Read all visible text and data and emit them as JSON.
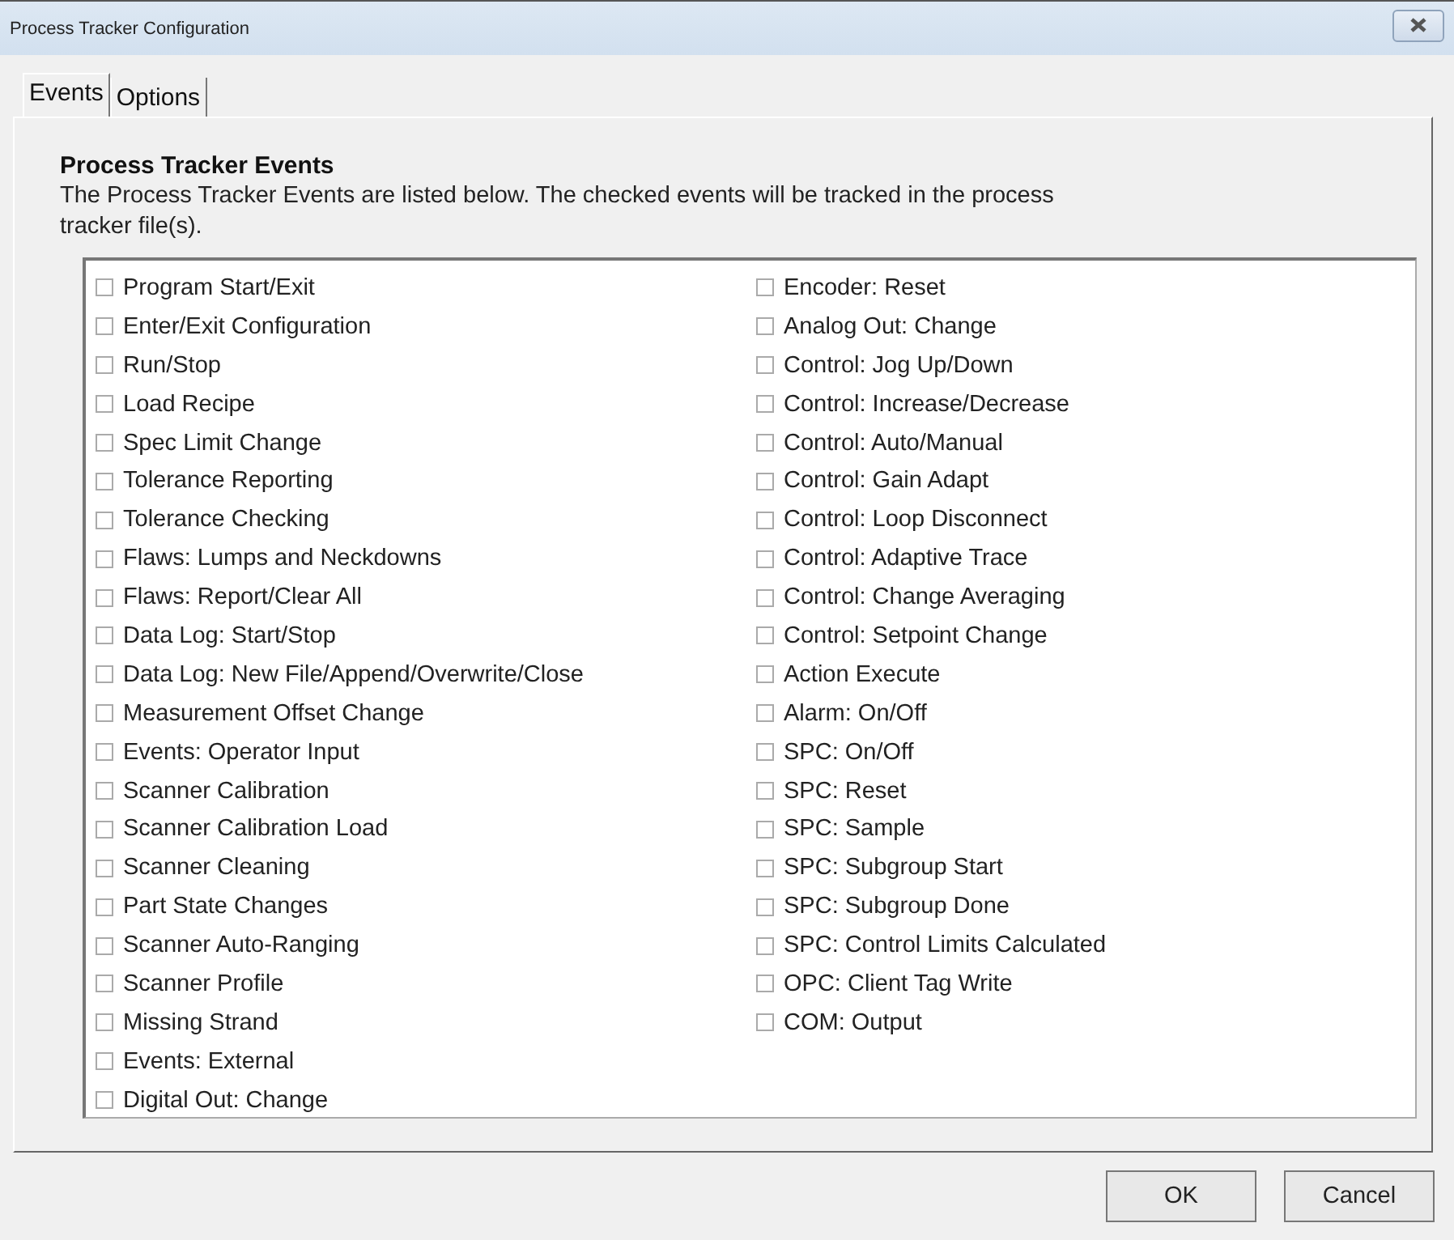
{
  "window": {
    "title": "Process Tracker Configuration"
  },
  "tabs": [
    {
      "label": "Events",
      "selected": true
    },
    {
      "label": "Options",
      "selected": false
    }
  ],
  "heading": "Process Tracker Events",
  "description": "The Process Tracker Events are listed below.  The checked events will be tracked in the process tracker file(s).",
  "event_columns": [
    [
      {
        "label": "Program Start/Exit",
        "checked": false
      },
      {
        "label": "Enter/Exit Configuration",
        "checked": false
      },
      {
        "label": "Run/Stop",
        "checked": false
      },
      {
        "label": "Load Recipe",
        "checked": false
      },
      {
        "label": "Spec Limit Change",
        "checked": false
      },
      {
        "label": "Tolerance Reporting",
        "checked": false
      },
      {
        "label": "Tolerance Checking",
        "checked": false
      },
      {
        "label": "Flaws: Lumps and Neckdowns",
        "checked": false
      },
      {
        "label": "Flaws: Report/Clear All",
        "checked": false
      },
      {
        "label": "Data Log: Start/Stop",
        "checked": false
      },
      {
        "label": "Data Log: New File/Append/Overwrite/Close",
        "checked": false
      },
      {
        "label": "Measurement Offset Change",
        "checked": false
      },
      {
        "label": "Events: Operator Input",
        "checked": false
      },
      {
        "label": "Scanner Calibration",
        "checked": false
      },
      {
        "label": "Scanner Calibration Load",
        "checked": false
      },
      {
        "label": "Scanner Cleaning",
        "checked": false
      },
      {
        "label": "Part State Changes",
        "checked": false
      },
      {
        "label": "Scanner Auto-Ranging",
        "checked": false
      },
      {
        "label": "Scanner Profile",
        "checked": false
      },
      {
        "label": "Missing Strand",
        "checked": false
      },
      {
        "label": "Events: External",
        "checked": false
      },
      {
        "label": "Digital Out: Change",
        "checked": false
      }
    ],
    [
      {
        "label": "Encoder: Reset",
        "checked": false
      },
      {
        "label": "Analog Out: Change",
        "checked": false
      },
      {
        "label": "Control: Jog Up/Down",
        "checked": false
      },
      {
        "label": "Control: Increase/Decrease",
        "checked": false
      },
      {
        "label": "Control: Auto/Manual",
        "checked": false
      },
      {
        "label": "Control: Gain Adapt",
        "checked": false
      },
      {
        "label": "Control: Loop Disconnect",
        "checked": false
      },
      {
        "label": "Control: Adaptive Trace",
        "checked": false
      },
      {
        "label": "Control: Change Averaging",
        "checked": false
      },
      {
        "label": "Control: Setpoint Change",
        "checked": false
      },
      {
        "label": "Action Execute",
        "checked": false
      },
      {
        "label": "Alarm: On/Off",
        "checked": false
      },
      {
        "label": "SPC: On/Off",
        "checked": false
      },
      {
        "label": "SPC: Reset",
        "checked": false
      },
      {
        "label": "SPC: Sample",
        "checked": false
      },
      {
        "label": "SPC: Subgroup Start",
        "checked": false
      },
      {
        "label": "SPC: Subgroup Done",
        "checked": false
      },
      {
        "label": "SPC: Control Limits Calculated",
        "checked": false
      },
      {
        "label": "OPC: Client Tag Write",
        "checked": false
      },
      {
        "label": "COM: Output",
        "checked": false
      }
    ]
  ],
  "buttons": [
    "OK",
    "Cancel"
  ]
}
